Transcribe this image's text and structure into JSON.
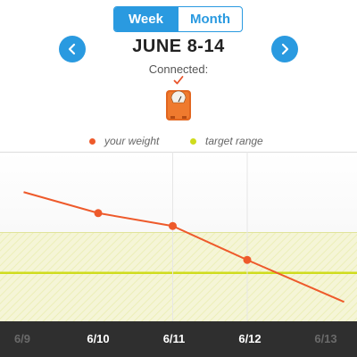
{
  "toggle": {
    "week_label": "Week",
    "month_label": "Month",
    "selected": "Week"
  },
  "header": {
    "title": "JUNE 8-14",
    "prev_icon": "chevron-left-icon",
    "next_icon": "chevron-right-icon"
  },
  "device": {
    "connected_label": "Connected:",
    "icon": "bathroom-scale-icon",
    "status_icon": "checkmark-icon"
  },
  "legend": [
    {
      "label": "your weight",
      "color": "#ee5a2b"
    },
    {
      "label": "target range",
      "color": "#cfdc1d"
    }
  ],
  "colors": {
    "accent": "#2a9ae0",
    "weight": "#ee5a2b",
    "target": "#cfdc1d",
    "axis_bar": "#2f2f2f"
  },
  "chart_data": {
    "type": "line",
    "x": [
      "6/9",
      "6/10",
      "6/11",
      "6/12",
      "6/13"
    ],
    "visible_x_labels": [
      {
        "label": "6/9",
        "dim": true
      },
      {
        "label": "6/10",
        "dim": false
      },
      {
        "label": "6/11",
        "dim": false
      },
      {
        "label": "6/12",
        "dim": false
      },
      {
        "label": "6/13",
        "dim": true
      }
    ],
    "series": [
      {
        "name": "your weight",
        "points": [
          {
            "x": 9.0,
            "y": 0.75
          },
          {
            "x": 10,
            "y": 0.62
          },
          {
            "x": 11,
            "y": 0.54
          },
          {
            "x": 12,
            "y": 0.33
          },
          {
            "x": 13.3,
            "y": 0.07
          }
        ],
        "markers_at": [
          10,
          11,
          12
        ]
      }
    ],
    "target_range": {
      "low": 0.0,
      "high": 0.5,
      "line": 0.25
    },
    "ylim": [
      -0.05,
      1.0
    ],
    "gridlines_x": [
      11,
      12
    ]
  }
}
